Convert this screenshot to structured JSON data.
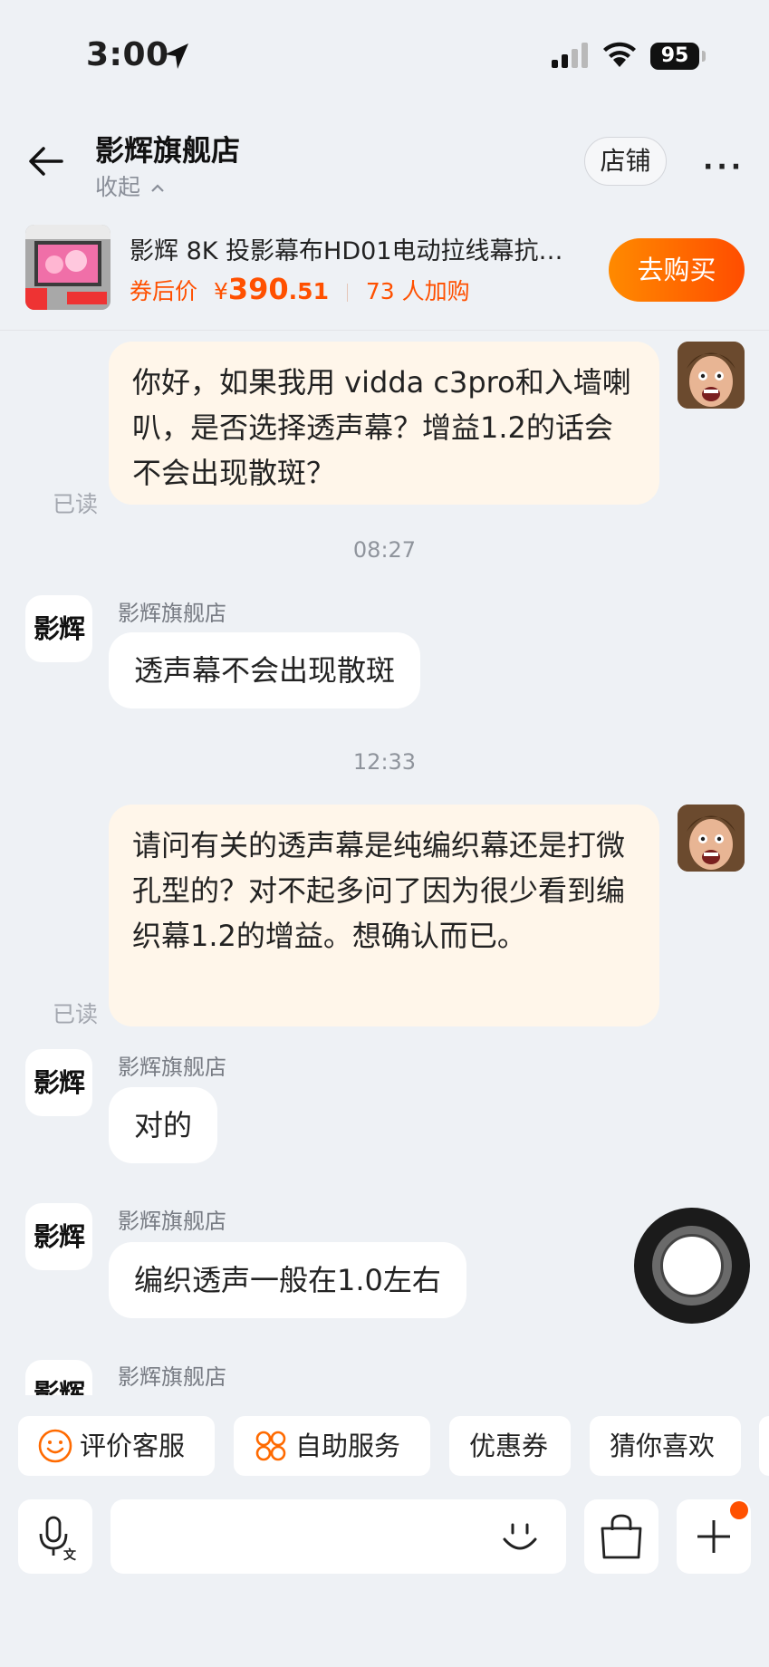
{
  "status_bar": {
    "time": "3:00",
    "battery": "95"
  },
  "header": {
    "title": "影辉旗舰店",
    "collapse_label": "收起",
    "shop_button": "店铺",
    "more_label": "···"
  },
  "product": {
    "name": "影辉 8K 投影幕布HD01电动拉线幕抗…",
    "price_label": "券后价",
    "currency": "¥",
    "price_int": "390",
    "price_dec": ".51",
    "buyers": "73 人加购",
    "buy_button": "去购买"
  },
  "chat": {
    "read_label": "已读",
    "store_avatar_text": "影辉",
    "store_name": "影辉旗舰店",
    "messages": [
      {
        "from": "me",
        "text": "你好，如果我用 vidda c3pro和入墙喇叭，是否选择透声幕？增益1.2的话会不会出现散斑？"
      },
      {
        "time": "08:27"
      },
      {
        "from": "store",
        "text": "透声幕不会出现散斑"
      },
      {
        "time": "12:33"
      },
      {
        "from": "me",
        "text": "请问有关的透声幕是纯编织幕还是打微孔型的？对不起多问了因为很少看到编织幕1.2的增益。想确认而已。"
      },
      {
        "from": "store",
        "text": "对的"
      },
      {
        "from": "store",
        "text": "编织透声一般在1.0左右"
      }
    ]
  },
  "quick_actions": [
    {
      "label": "评价客服",
      "icon": "smile-icon"
    },
    {
      "label": "自助服务",
      "icon": "grid-icon"
    },
    {
      "label": "优惠券",
      "icon": ""
    },
    {
      "label": "猜你喜欢",
      "icon": ""
    }
  ],
  "input_bar": {
    "icons": [
      "voice-translate-icon",
      "emoji-icon",
      "shopping-bag-icon",
      "plus-icon"
    ]
  },
  "colors": {
    "accent": "#ff5000",
    "my_bubble": "#fff6ea",
    "background": "#eef1f5"
  }
}
